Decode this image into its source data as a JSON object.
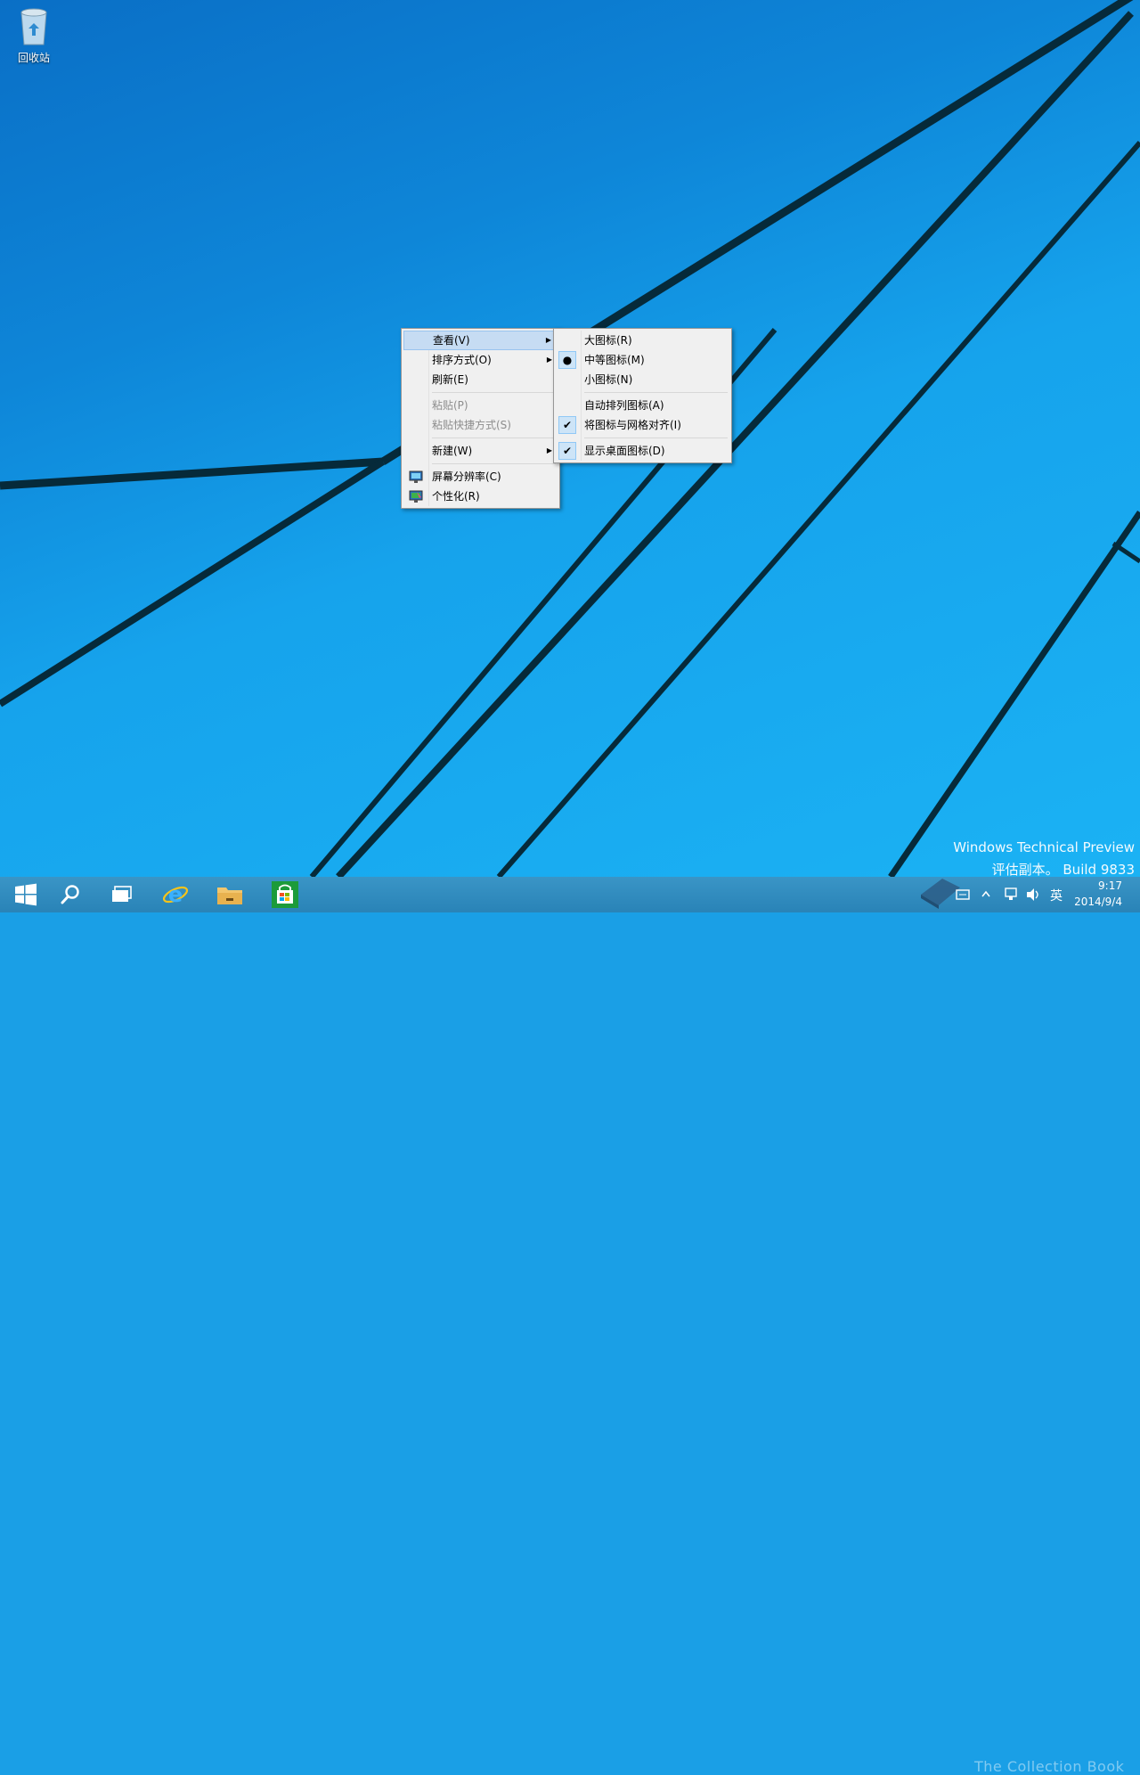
{
  "desktop": {
    "icons": [
      {
        "label": "回收站",
        "icon": "recycle-bin-icon"
      }
    ],
    "watermark": {
      "line1": "Windows Technical Preview",
      "line2": "评估副本。 Build 9833"
    }
  },
  "context_menu": {
    "items": [
      {
        "label": "查看(V)",
        "highlighted": true,
        "submenu": true
      },
      {
        "label": "排序方式(O)",
        "submenu": true
      },
      {
        "label": "刷新(E)"
      },
      {
        "separator": true
      },
      {
        "label": "粘贴(P)",
        "disabled": true
      },
      {
        "label": "粘贴快捷方式(S)",
        "disabled": true
      },
      {
        "separator": true
      },
      {
        "label": "新建(W)",
        "submenu": true
      },
      {
        "separator": true
      },
      {
        "label": "屏幕分辨率(C)",
        "icon": "display-settings-icon"
      },
      {
        "label": "个性化(R)",
        "icon": "personalize-icon"
      }
    ]
  },
  "view_submenu": {
    "items": [
      {
        "label": "大图标(R)"
      },
      {
        "label": "中等图标(M)",
        "state": "radio-selected"
      },
      {
        "label": "小图标(N)"
      },
      {
        "separator": true
      },
      {
        "label": "自动排列图标(A)"
      },
      {
        "label": "将图标与网格对齐(I)",
        "state": "checked"
      },
      {
        "separator": true
      },
      {
        "label": "显示桌面图标(D)",
        "state": "checked"
      }
    ]
  },
  "taskbar": {
    "buttons": [
      {
        "name": "start",
        "icon": "windows-logo-icon"
      },
      {
        "name": "search",
        "icon": "search-icon"
      },
      {
        "name": "task-view",
        "icon": "task-view-icon"
      },
      {
        "name": "internet-explorer",
        "icon": "internet-explorer-icon"
      },
      {
        "name": "file-explorer",
        "icon": "folder-icon"
      },
      {
        "name": "store",
        "icon": "store-icon"
      }
    ],
    "tray": {
      "ime": "英",
      "time": "9:17",
      "date": "2014/9/4",
      "overlay_text": "The Collection Book"
    }
  },
  "colors": {
    "accent": "#1a9fe6",
    "taskbar": "#2b88bd",
    "menu_bg": "#f0f0f0",
    "menu_highlight": "#c6dcf3"
  }
}
